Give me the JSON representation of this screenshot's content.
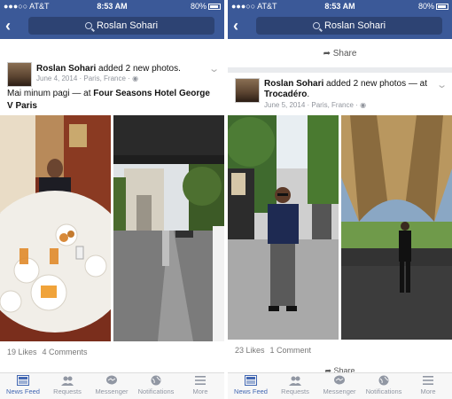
{
  "status": {
    "carrier": "●●●○○ AT&T",
    "time": "8:53 AM",
    "battery": "80%"
  },
  "search": {
    "query": "Roslan Sohari"
  },
  "left_post": {
    "author": "Roslan Sohari",
    "action": " added 2 new photos.",
    "date": "June 4, 2014",
    "location": "Paris, France",
    "caption_text": "Mai minum pagi",
    "caption_at": " — at ",
    "place": "Four Seasons Hotel George V Paris",
    "likes": "19 Likes",
    "comments": "4 Comments"
  },
  "right_post": {
    "share_label": "Share",
    "author": "Roslan Sohari",
    "action": " added 2 new photos — at ",
    "place": "Trocadéro",
    "date": "June 5, 2014",
    "location": "Paris, France",
    "likes": "23 Likes",
    "comments": "1 Comment",
    "bottom_share": "Share"
  },
  "tabs": [
    {
      "label": "News Feed",
      "icon": "news-feed-icon"
    },
    {
      "label": "Requests",
      "icon": "requests-icon"
    },
    {
      "label": "Messenger",
      "icon": "messenger-icon"
    },
    {
      "label": "Notifications",
      "icon": "globe-icon"
    },
    {
      "label": "More",
      "icon": "menu-icon"
    }
  ],
  "colors": {
    "brand": "#3b5998",
    "active_tab": "#4267b2"
  }
}
